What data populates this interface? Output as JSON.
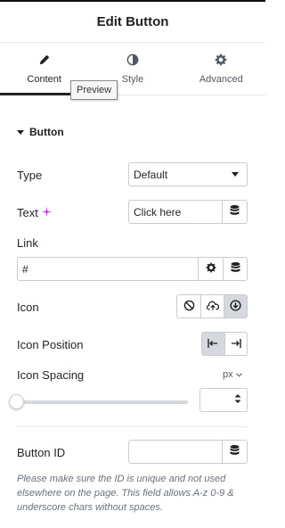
{
  "header": {
    "title": "Edit Button"
  },
  "tabs": [
    {
      "label": "Content",
      "icon": "pencil-icon",
      "active": true
    },
    {
      "label": "Style",
      "icon": "half-circle-icon",
      "active": false
    },
    {
      "label": "Advanced",
      "icon": "gear-icon",
      "active": false
    }
  ],
  "tooltip": {
    "text": "Preview"
  },
  "section": {
    "title": "Button"
  },
  "fields": {
    "type": {
      "label": "Type",
      "value": "Default"
    },
    "text": {
      "label": "Text",
      "value": "Click here",
      "ai_icon": "sparkle-icon"
    },
    "link": {
      "label": "Link",
      "value": "#"
    },
    "icon": {
      "label": "Icon",
      "options": [
        "none-icon",
        "upload-icon",
        "download-circle-icon"
      ],
      "selected": 2
    },
    "icon_position": {
      "label": "Icon Position",
      "options": [
        "align-start-icon",
        "align-end-icon"
      ],
      "selected": 0
    },
    "icon_spacing": {
      "label": "Icon Spacing",
      "unit": "px",
      "value": 0
    },
    "button_id": {
      "label": "Button ID",
      "value": ""
    }
  },
  "note": "Please make sure the ID is unique and not used elsewhere on the page. This field allows A-z  0-9 & underscore chars without spaces.",
  "colors": {
    "accent": "#1f2124",
    "ai": "#c036e0",
    "border": "#c9cdd2",
    "selected_bg": "#d5d8dc"
  }
}
